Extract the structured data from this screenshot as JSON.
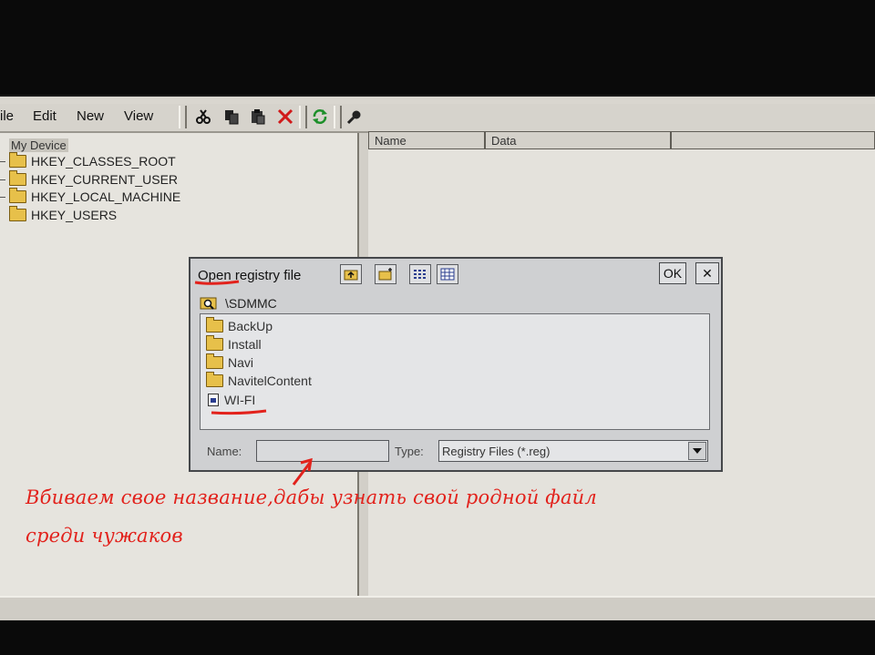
{
  "menu": {
    "file_label": "ile",
    "edit_label": "Edit",
    "new_label": "New",
    "view_label": "View"
  },
  "toolbar": {
    "icons": [
      "cut-icon",
      "copy-icon",
      "paste-icon",
      "delete-icon",
      "refresh-icon",
      "find-icon"
    ],
    "delete_color": "#d11a1a",
    "refresh_color": "#1d8f2a"
  },
  "tree": {
    "root": "My Device",
    "items": [
      {
        "label": "HKEY_CLASSES_ROOT"
      },
      {
        "label": "HKEY_CURRENT_USER"
      },
      {
        "label": "HKEY_LOCAL_MACHINE"
      },
      {
        "label": "HKEY_USERS"
      }
    ]
  },
  "list": {
    "columns": [
      "Name",
      "Data"
    ]
  },
  "dialog": {
    "title": "Open registry file",
    "ok_label": "OK",
    "close_label": "✕",
    "path": "\\SDMMC",
    "items": [
      {
        "label": "BackUp",
        "icon": "folder-icon"
      },
      {
        "label": "Install",
        "icon": "folder-icon"
      },
      {
        "label": "Navi",
        "icon": "folder-icon"
      },
      {
        "label": "NavitelContent",
        "icon": "folder-icon"
      },
      {
        "label": "WI-FI",
        "icon": "registry-file-icon"
      }
    ],
    "name_label": "Name:",
    "name_value": "",
    "type_label": "Type:",
    "type_value": "Registry Files (*.reg)"
  },
  "annotation": {
    "line1": "Вбиваем свое название,дабы узнать свой родной файл",
    "line2": "среди чужаков",
    "color": "#e2221c"
  }
}
